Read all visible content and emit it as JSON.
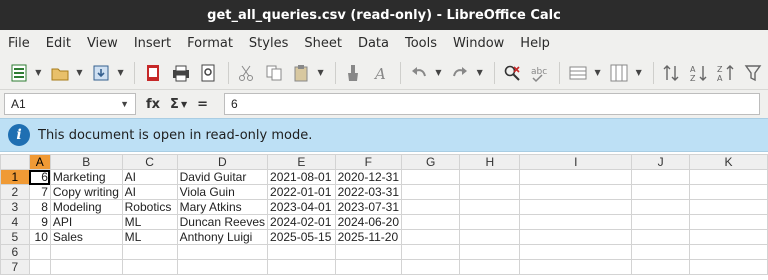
{
  "window": {
    "title": "get_all_queries.csv (read-only) - LibreOffice Calc"
  },
  "menu": [
    "File",
    "Edit",
    "View",
    "Insert",
    "Format",
    "Styles",
    "Sheet",
    "Data",
    "Tools",
    "Window",
    "Help"
  ],
  "formula_bar": {
    "cell_ref": "A1",
    "fx_symbol": "fx",
    "sum_symbol": "Σ",
    "equals_symbol": "=",
    "content": "6"
  },
  "infobar": {
    "message": "This document is open in read-only mode."
  },
  "columns": [
    "A",
    "B",
    "C",
    "D",
    "E",
    "F",
    "G",
    "H",
    "I",
    "J",
    "K"
  ],
  "active_column": "A",
  "active_row": "1",
  "rows": [
    {
      "num": "1",
      "cells": [
        "6",
        "Marketing",
        "AI",
        "David Guitar",
        "2021-08-01",
        "2020-12-31"
      ]
    },
    {
      "num": "2",
      "cells": [
        "7",
        "Copy writing",
        "AI",
        "Viola Guin",
        "2022-01-01",
        "2022-03-31"
      ]
    },
    {
      "num": "3",
      "cells": [
        "8",
        "Modeling",
        "Robotics",
        "Mary Atkins",
        "2023-04-01",
        "2023-07-31"
      ]
    },
    {
      "num": "4",
      "cells": [
        "9",
        "API",
        "ML",
        "Duncan Reeves",
        "2024-02-01",
        "2024-06-20"
      ]
    },
    {
      "num": "5",
      "cells": [
        "10",
        "Sales",
        "ML",
        "Anthony Luigi",
        "2025-05-15",
        "2025-11-20"
      ]
    },
    {
      "num": "6",
      "cells": [
        "",
        "",
        "",
        "",
        "",
        ""
      ]
    },
    {
      "num": "7",
      "cells": [
        "",
        "",
        "",
        "",
        "",
        ""
      ]
    }
  ],
  "colors": {
    "titlebar": "#2c2c2c",
    "infobar": "#bde0f5",
    "active_header": "#f09a35",
    "info_icon": "#1f6fb2"
  }
}
